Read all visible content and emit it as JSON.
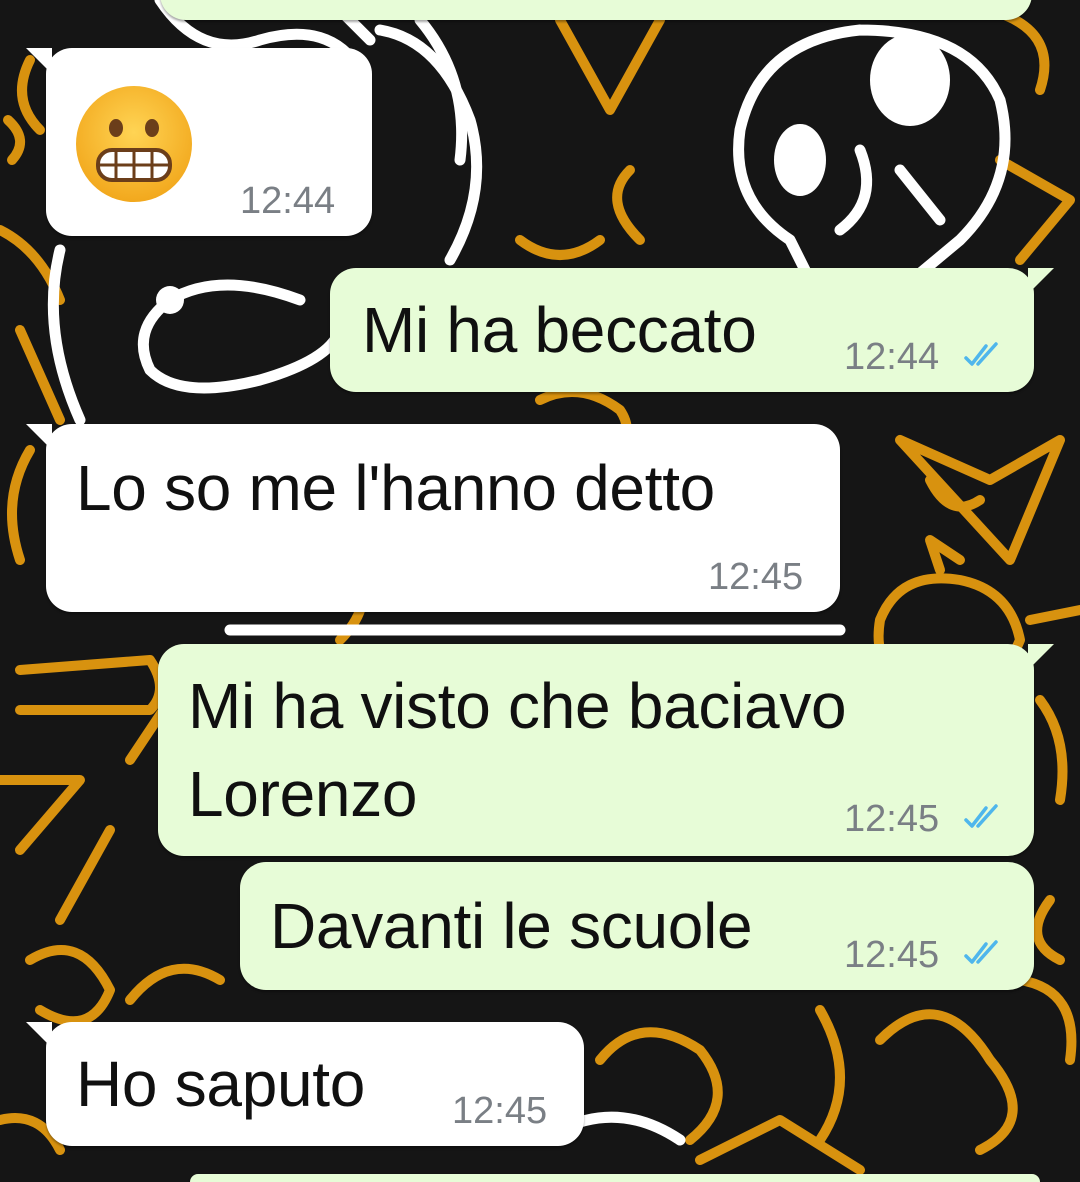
{
  "colors": {
    "incoming_bubble": "#ffffff",
    "outgoing_bubble": "#e7fcd7",
    "wallpaper": "#151515",
    "doodle_orange": "#d8920f",
    "doodle_white": "#ffffff",
    "tick_blue": "#4fb6ec",
    "time_gray": "#7a7f85"
  },
  "messages": [
    {
      "direction": "incoming",
      "content": "grimacing-face-emoji",
      "time": "12:44"
    },
    {
      "direction": "outgoing",
      "text": "Mi ha beccato",
      "time": "12:44",
      "status": "read-double-check-icon"
    },
    {
      "direction": "incoming",
      "text": "Lo so me l'hanno detto",
      "time": "12:45"
    },
    {
      "direction": "outgoing",
      "lines": [
        "Mi ha visto che baciavo",
        "Lorenzo"
      ],
      "time": "12:45",
      "status": "read-double-check-icon"
    },
    {
      "direction": "outgoing",
      "text": "Davanti le scuole",
      "time": "12:45",
      "status": "read-double-check-icon"
    },
    {
      "direction": "incoming",
      "text": "Ho saputo",
      "time": "12:45"
    }
  ]
}
